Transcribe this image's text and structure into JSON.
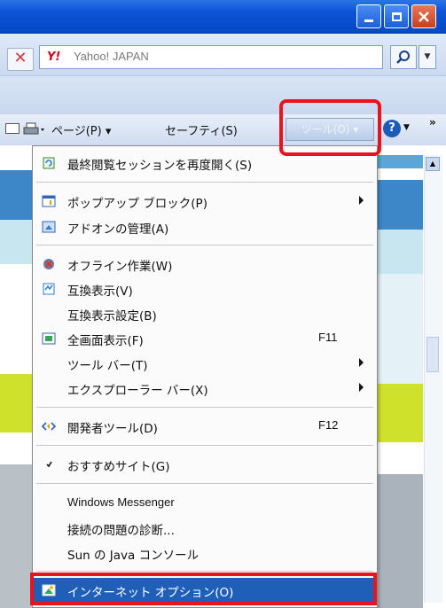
{
  "search": {
    "provider": "Yahoo! JAPAN",
    "logo": "Y!"
  },
  "commandbar": {
    "page": "ページ(P)",
    "safety": "セーフティ(S)",
    "tools": "ツール(O)",
    "help": "?",
    "more": "»"
  },
  "menu": {
    "items": [
      {
        "label": "最終閲覧セッションを再度開く(S)",
        "icon": "reopen-session-icon"
      },
      {
        "label": "ポップアップ ブロック(P)",
        "icon": "popup-blocker-icon",
        "submenu": true
      },
      {
        "label": "アドオンの管理(A)",
        "icon": "addons-icon"
      },
      {
        "label": "オフライン作業(W)",
        "icon": "offline-icon"
      },
      {
        "label": "互換表示(V)",
        "icon": "compat-view-icon"
      },
      {
        "label": "互換表示設定(B)"
      },
      {
        "label": "全画面表示(F)",
        "icon": "fullscreen-icon",
        "shortcut": "F11"
      },
      {
        "label": "ツール バー(T)",
        "submenu": true
      },
      {
        "label": "エクスプローラー バー(X)",
        "submenu": true
      },
      {
        "label": "開発者ツール(D)",
        "icon": "developer-tools-icon",
        "shortcut": "F12"
      },
      {
        "label": "おすすめサイト(G)",
        "checked": true
      },
      {
        "label": "Windows Messenger"
      },
      {
        "label": "接続の問題の診断..."
      },
      {
        "label": "Sun の Java コンソール"
      },
      {
        "label": "インターネット オプション(O)",
        "icon": "internet-options-icon",
        "highlighted": true
      }
    ]
  },
  "colors": {
    "highlight_red": "#e8131c",
    "menu_selection": "#1f5fb8",
    "titlebar": "#0a55d6"
  }
}
